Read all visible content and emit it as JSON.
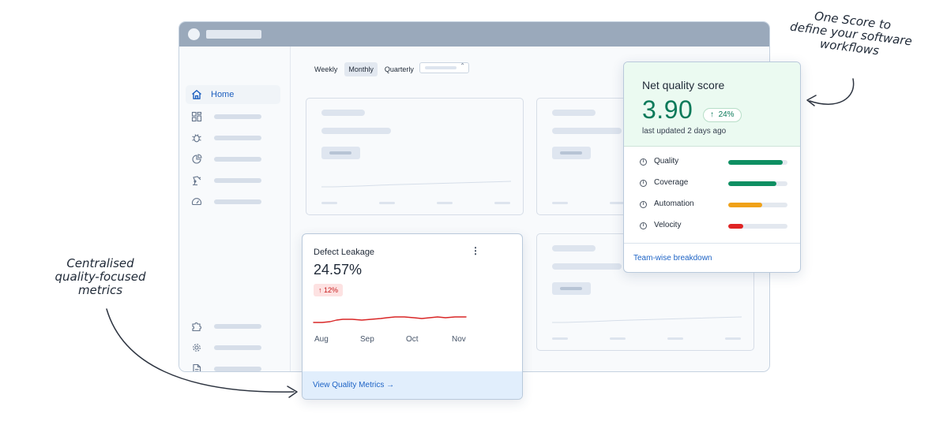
{
  "app": {
    "sidebar": {
      "home_label": "Home",
      "items_top": [
        "grid-icon",
        "bug-icon",
        "pie-chart-icon",
        "robot-arm-icon",
        "speedometer-icon"
      ],
      "items_bottom": [
        "puzzle-icon",
        "gear-icon",
        "document-icon"
      ]
    },
    "filters": {
      "options": [
        "Weekly",
        "Monthly",
        "Quarterly"
      ],
      "active": "Monthly"
    }
  },
  "defect_card": {
    "title": "Defect Leakage",
    "value": "24.57%",
    "change": "12%",
    "months": [
      "Aug",
      "Sep",
      "Oct",
      "Nov"
    ],
    "link": "View Quality Metrics →",
    "trend_color": "#d92626"
  },
  "score_card": {
    "title": "Net quality score",
    "value": "3.90",
    "change": "24%",
    "updated": "last updated 2 days ago",
    "metrics": [
      {
        "label": "Quality",
        "level": 0.92,
        "color": "#0e8f62"
      },
      {
        "label": "Coverage",
        "level": 0.81,
        "color": "#0e8f62"
      },
      {
        "label": "Automation",
        "level": 0.57,
        "color": "#f0a118"
      },
      {
        "label": "Velocity",
        "level": 0.25,
        "color": "#e02424"
      }
    ],
    "link": "Team-wise breakdown"
  },
  "annotations": {
    "left": [
      "Centralised",
      "quality-focused",
      "metrics"
    ],
    "right": [
      "One Score to",
      "define your software",
      "workflows"
    ]
  }
}
